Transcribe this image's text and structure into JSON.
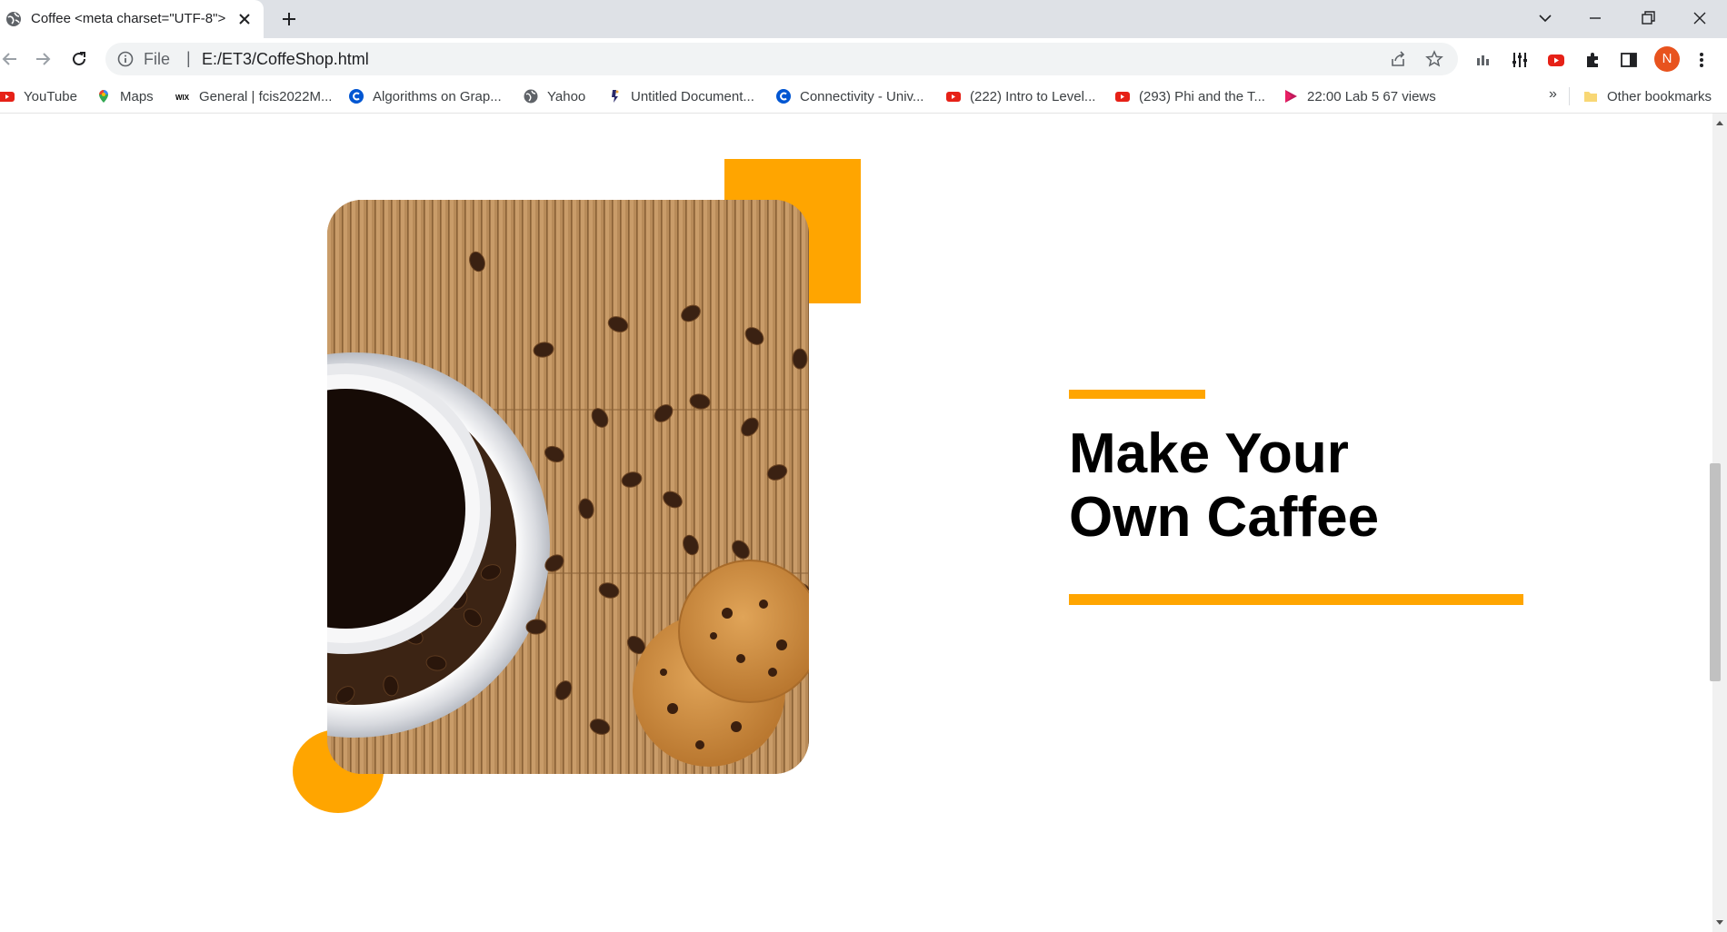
{
  "browser": {
    "tab": {
      "title": "Coffee <meta charset=\"UTF-8\">",
      "favicon": "globe-icon"
    },
    "address": {
      "scheme": "File",
      "separator": "|",
      "url": "E:/ET3/CoffeShop.html"
    },
    "profile_initial": "N",
    "bookmarks": [
      {
        "label": "YouTube",
        "icon": "youtube-icon"
      },
      {
        "label": "Maps",
        "icon": "maps-icon"
      },
      {
        "label": "General | fcis2022M...",
        "icon": "wix-icon"
      },
      {
        "label": "Algorithms on Grap...",
        "icon": "coursera-icon"
      },
      {
        "label": "Yahoo",
        "icon": "globe-icon"
      },
      {
        "label": "Untitled Document...",
        "icon": "document-icon"
      },
      {
        "label": "Connectivity - Univ...",
        "icon": "coursera-icon"
      },
      {
        "label": "(222) Intro to Level...",
        "icon": "youtube-icon"
      },
      {
        "label": "(293) Phi and the T...",
        "icon": "youtube-icon"
      },
      {
        "label": "22:00 Lab 5 67 views",
        "icon": "play-icon"
      }
    ],
    "overflow": "»",
    "other_bookmarks": "Other bookmarks"
  },
  "hero": {
    "title_line1": "Make Your",
    "title_line2": "Own Caffee"
  },
  "colors": {
    "accent": "#ffa500",
    "text": "#000000",
    "chrome_bg": "#dee1e6",
    "omnibox_bg": "#f1f3f4"
  }
}
